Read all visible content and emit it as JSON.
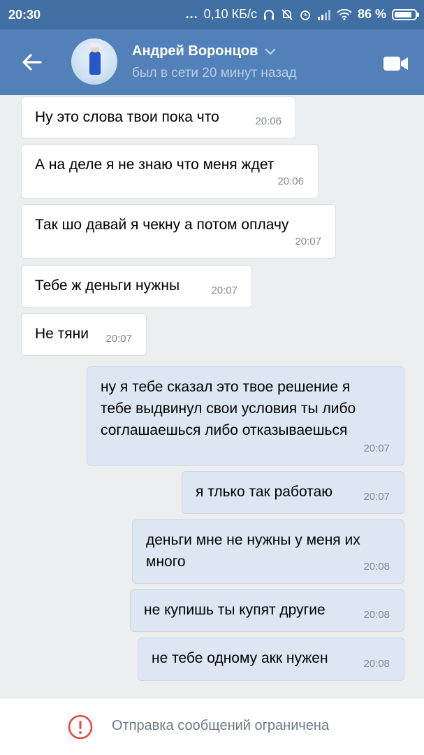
{
  "status_bar": {
    "time": "20:30",
    "dots": "...",
    "speed": "0,10 КБ/с",
    "battery_percent": "86 %",
    "battery_level": 0.86,
    "icons": [
      "headphones-icon",
      "mute-icon",
      "alarm-icon",
      "signal-icon",
      "wifi-icon",
      "battery-icon"
    ]
  },
  "header": {
    "name": "Андрей Воронцов",
    "status": "был в сети 20 минут назад",
    "icons": [
      "back-arrow-icon",
      "chevron-down-icon",
      "video-call-icon"
    ],
    "colors": {
      "bar": "#5181b8",
      "status_bar": "#3f6fa3"
    }
  },
  "messages": [
    {
      "dir": "in",
      "text": "Ну это слова твои пока что",
      "time": "20:06"
    },
    {
      "dir": "in",
      "text": "А на деле я не знаю что меня ждет",
      "time": "20:06"
    },
    {
      "dir": "in",
      "text": "Так шо давай я чекну а потом оплачу",
      "time": "20:07"
    },
    {
      "dir": "in",
      "text": "Тебе ж деньги нужны",
      "time": "20:07"
    },
    {
      "dir": "in",
      "text": "Не тяни",
      "time": "20:07"
    },
    {
      "dir": "out",
      "text": "ну я тебе сказал это твое решение я\nтебе выдвинул свои условия ты либо\nсоглашаешься либо отказываешься",
      "time": "20:07"
    },
    {
      "dir": "out",
      "text": "я тлько так работаю",
      "time": "20:07"
    },
    {
      "dir": "out",
      "text": "деньги мне не нужны у меня их\nмного",
      "time": "20:08"
    },
    {
      "dir": "out",
      "text": "не купишь ты купят другие",
      "time": "20:08"
    },
    {
      "dir": "out",
      "text": "не тебе одному акк нужен",
      "time": "20:08"
    }
  ],
  "footer": {
    "restriction_text": "Отправка сообщений ограничена",
    "icon": "exclamation-circle-icon",
    "accent": "#e64646"
  }
}
